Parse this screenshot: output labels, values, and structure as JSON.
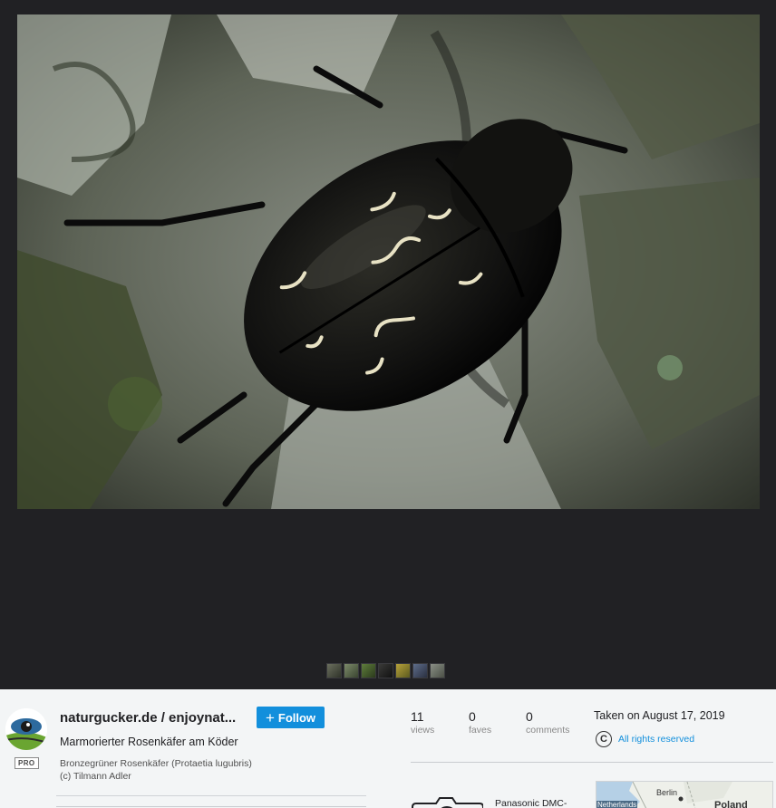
{
  "photo": {
    "subject": "Marmorierter Rosenkäfer am Köder"
  },
  "thumbnails": [
    "thumb-1",
    "thumb-2",
    "thumb-3",
    "thumb-4",
    "thumb-5",
    "thumb-6",
    "thumb-7"
  ],
  "owner": {
    "name": "naturgucker.de / enjoynat...",
    "badge": "PRO",
    "follow_label": "Follow"
  },
  "photo_info": {
    "title": "Marmorierter Rosenkäfer am Köder",
    "description_line1": "Bronzegrüner Rosenkäfer (Protaetia lugubris)",
    "description_line2": "(c) Tilmann Adler"
  },
  "stats": {
    "views": {
      "value": "11",
      "label": "views"
    },
    "faves": {
      "value": "0",
      "label": "faves"
    },
    "comments": {
      "value": "0",
      "label": "comments"
    }
  },
  "taken": "Taken on August 17, 2019",
  "license": {
    "symbol": "C",
    "text": "All rights reserved"
  },
  "camera": {
    "name": "Panasonic DMC-",
    "icon": "camera-icon"
  },
  "map": {
    "labels": [
      "Berlin",
      "Netherlands",
      "Poland"
    ]
  },
  "colors": {
    "accent": "#128fdc",
    "viewer_bg": "#212124",
    "panel_bg": "#f3f5f6"
  }
}
